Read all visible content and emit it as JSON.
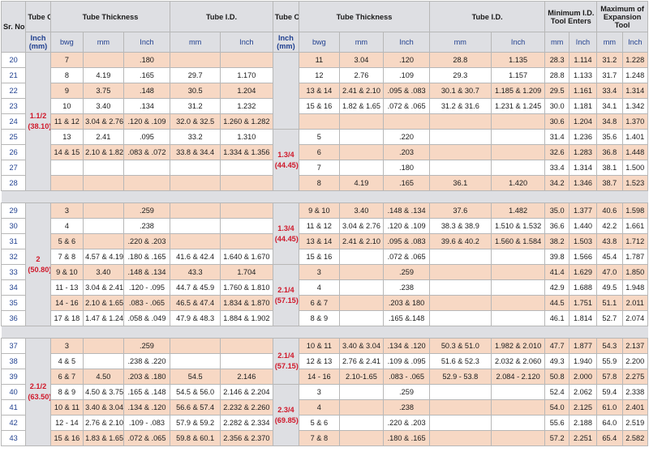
{
  "headers": {
    "sr_no": "Sr. No.",
    "tube_od": "Tube O.D.",
    "tube_thickness": "Tube Thickness",
    "tube_id": "Tube I.D.",
    "min_id_tool_enters": "Minimum I.D. Tool Enters",
    "max_expansion_tool": "Maximum of Expansion Tool",
    "inch_mm": "Inch (mm)",
    "bwg": "bwg",
    "mm": "mm",
    "inch": "Inch"
  },
  "sections": [
    {
      "left_od": "1.1/2\n(38.10)",
      "rows": [
        {
          "sr": "20",
          "lb": "7",
          "lm": "",
          "li": ".180",
          "im": "",
          "ii": "",
          "rod": "",
          "rb": "11",
          "rm": "3.04",
          "ri": ".120",
          "rim": "28.8",
          "rii": "1.135",
          "mm": "28.3",
          "mi": "1.114",
          "xm": "31.2",
          "xi": "1.228"
        },
        {
          "sr": "21",
          "lb": "8",
          "lm": "4.19",
          "li": ".165",
          "im": "29.7",
          "ii": "1.170",
          "rod": "1.3/8\n(34.92)",
          "rb": "12",
          "rm": "2.76",
          "ri": ".109",
          "rim": "29.3",
          "rii": "1.157",
          "mm": "28.8",
          "mi": "1.133",
          "xm": "31.7",
          "xi": "1.248"
        },
        {
          "sr": "22",
          "lb": "9",
          "lm": "3.75",
          "li": ".148",
          "im": "30.5",
          "ii": "1.204",
          "rod": "",
          "rb": "13 & 14",
          "rm": "2.41 & 2.10",
          "ri": ".095 & .083",
          "rim": "30.1 & 30.7",
          "rii": "1.185 & 1.209",
          "mm": "29.5",
          "mi": "1.161",
          "xm": "33.4",
          "xi": "1.314"
        },
        {
          "sr": "23",
          "lb": "10",
          "lm": "3.40",
          "li": ".134",
          "im": "31.2",
          "ii": "1.232",
          "rod": "",
          "rb": "15 & 16",
          "rm": "1.82 & 1.65",
          "ri": ".072 & .065",
          "rim": "31.2 & 31.6",
          "rii": "1.231 & 1.245",
          "mm": "30.0",
          "mi": "1.181",
          "xm": "34.1",
          "xi": "1.342"
        },
        {
          "sr": "24",
          "lb": "11 & 12",
          "lm": "3.04 & 2.76",
          "li": ".120 & .109",
          "im": "32.0 & 32.5",
          "ii": "1.260 & 1.282",
          "rod": "",
          "rb": "",
          "rm": "",
          "ri": "",
          "rim": "",
          "rii": "",
          "mm": "30.6",
          "mi": "1.204",
          "xm": "34.8",
          "xi": "1.370"
        },
        {
          "sr": "25",
          "lb": "13",
          "lm": "2.41",
          "li": ".095",
          "im": "33.2",
          "ii": "1.310",
          "rod": "1.3/4\n(44.45)",
          "rb": "5",
          "rm": "",
          "ri": ".220",
          "rim": "",
          "rii": "",
          "mm": "31.4",
          "mi": "1.236",
          "xm": "35.6",
          "xi": "1.401"
        },
        {
          "sr": "26",
          "lb": "14 & 15",
          "lm": "2.10 & 1.82",
          "li": ".083 & .072",
          "im": "33.8 & 34.4",
          "ii": "1.334 & 1.356",
          "rod": "",
          "rb": "6",
          "rm": "",
          "ri": ".203",
          "rim": "",
          "rii": "",
          "mm": "32.6",
          "mi": "1.283",
          "xm": "36.8",
          "xi": "1.448"
        },
        {
          "sr": "27",
          "lb": "",
          "lm": "",
          "li": "",
          "im": "",
          "ii": "",
          "rod": "",
          "rb": "7",
          "rm": "",
          "ri": ".180",
          "rim": "",
          "rii": "",
          "mm": "33.4",
          "mi": "1.314",
          "xm": "38.1",
          "xi": "1.500"
        },
        {
          "sr": "28",
          "lb": "",
          "lm": "",
          "li": "",
          "im": "",
          "ii": "",
          "rod": "",
          "rb": "8",
          "rm": "4.19",
          "ri": ".165",
          "rim": "36.1",
          "rii": "1.420",
          "mm": "34.2",
          "mi": "1.346",
          "xm": "38.7",
          "xi": "1.523"
        }
      ]
    },
    {
      "left_od": "2\n(50.80)",
      "rows": [
        {
          "sr": "29",
          "lb": "3",
          "lm": "",
          "li": ".259",
          "im": "",
          "ii": "",
          "rod": "1.3/4\n(44.45)",
          "rb": "9 & 10",
          "rm": "3.40",
          "ri": ".148 & .134",
          "rim": "37.6",
          "rii": "1.482",
          "mm": "35.0",
          "mi": "1.377",
          "xm": "40.6",
          "xi": "1.598"
        },
        {
          "sr": "30",
          "lb": "4",
          "lm": "",
          "li": ".238",
          "im": "",
          "ii": "",
          "rod": "",
          "rb": "11 & 12",
          "rm": "3.04 & 2.76",
          "ri": ".120 & .109",
          "rim": "38.3 & 38.9",
          "rii": "1.510 & 1.532",
          "mm": "36.6",
          "mi": "1.440",
          "xm": "42.2",
          "xi": "1.661"
        },
        {
          "sr": "31",
          "lb": "5 & 6",
          "lm": "",
          "li": ".220 & .203",
          "im": "",
          "ii": "",
          "rod": "",
          "rb": "13 & 14",
          "rm": "2.41 & 2.10",
          "ri": ".095 & .083",
          "rim": "39.6 & 40.2",
          "rii": "1.560 & 1.584",
          "mm": "38.2",
          "mi": "1.503",
          "xm": "43.8",
          "xi": "1.712"
        },
        {
          "sr": "32",
          "lb": "7 & 8",
          "lm": "4.57 & 4.19",
          "li": ".180 & .165",
          "im": "41.6 & 42.4",
          "ii": "1.640 & 1.670",
          "rod": "",
          "rb": "15 & 16",
          "rm": "",
          "ri": ".072 & .065",
          "rim": "",
          "rii": "",
          "mm": "39.8",
          "mi": "1.566",
          "xm": "45.4",
          "xi": "1.787"
        },
        {
          "sr": "33",
          "lb": "9 & 10",
          "lm": "3.40",
          "li": ".148 & .134",
          "im": "43.3",
          "ii": "1.704",
          "rod": "2.1/4\n(57.15)",
          "rb": "3",
          "rm": "",
          "ri": ".259",
          "rim": "",
          "rii": "",
          "mm": "41.4",
          "mi": "1.629",
          "xm": "47.0",
          "xi": "1.850"
        },
        {
          "sr": "34",
          "lb": "11 - 13",
          "lm": "3.04 & 2.41",
          "li": ".120 - .095",
          "im": "44.7 & 45.9",
          "ii": "1.760 & 1.810",
          "rod": "",
          "rb": "4",
          "rm": "",
          "ri": ".238",
          "rim": "",
          "rii": "",
          "mm": "42.9",
          "mi": "1.688",
          "xm": "49.5",
          "xi": "1.948"
        },
        {
          "sr": "35",
          "lb": "14 - 16",
          "lm": "2.10 & 1.65",
          "li": ".083 - .065",
          "im": "46.5 & 47.4",
          "ii": "1.834 & 1.870",
          "rod": "",
          "rb": "6 & 7",
          "rm": "",
          "ri": ".203 & 180",
          "rim": "",
          "rii": "",
          "mm": "44.5",
          "mi": "1.751",
          "xm": "51.1",
          "xi": "2.011"
        },
        {
          "sr": "36",
          "lb": "17 & 18",
          "lm": "1.47 & 1.24",
          "li": ".058 & .049",
          "im": "47.9 & 48.3",
          "ii": "1.884 & 1.902",
          "rod": "",
          "rb": "8 & 9",
          "rm": "",
          "ri": ".165 &.148",
          "rim": "",
          "rii": "",
          "mm": "46.1",
          "mi": "1.814",
          "xm": "52.7",
          "xi": "2.074"
        }
      ]
    },
    {
      "left_od": "2.1/2\n(63.50)",
      "rows": [
        {
          "sr": "37",
          "lb": "3",
          "lm": "",
          "li": ".259",
          "im": "",
          "ii": "",
          "rod": "2.1/4\n(57.15)",
          "rb": "10 & 11",
          "rm": "3.40 & 3.04",
          "ri": ".134 & .120",
          "rim": "50.3 & 51.0",
          "rii": "1.982 & 2.010",
          "mm": "47.7",
          "mi": "1.877",
          "xm": "54.3",
          "xi": "2.137"
        },
        {
          "sr": "38",
          "lb": "4 & 5",
          "lm": "",
          "li": ".238 & .220",
          "im": "",
          "ii": "",
          "rod": "",
          "rb": "12 & 13",
          "rm": "2.76 & 2.41",
          "ri": ".109 & .095",
          "rim": "51.6 & 52.3",
          "rii": "2.032 & 2.060",
          "mm": "49.3",
          "mi": "1.940",
          "xm": "55.9",
          "xi": "2.200"
        },
        {
          "sr": "39",
          "lb": "6 & 7",
          "lm": "4.50",
          "li": ".203 & .180",
          "im": "54.5",
          "ii": "2.146",
          "rod": "",
          "rb": "14 - 16",
          "rm": "2.10-1.65",
          "ri": ".083 - .065",
          "rim": "52.9 - 53.8",
          "rii": "2.084 - 2.120",
          "mm": "50.8",
          "mi": "2.000",
          "xm": "57.8",
          "xi": "2.275"
        },
        {
          "sr": "40",
          "lb": "8 & 9",
          "lm": "4.50 & 3.75",
          "li": ".165 & .148",
          "im": "54.5 & 56.0",
          "ii": "2.146 & 2.204",
          "rod": "2.3/4\n(69.85)",
          "rb": "3",
          "rm": "",
          "ri": ".259",
          "rim": "",
          "rii": "",
          "mm": "52.4",
          "mi": "2.062",
          "xm": "59.4",
          "xi": "2.338"
        },
        {
          "sr": "41",
          "lb": "10 & 11",
          "lm": "3.40 & 3.04",
          "li": ".134 & .120",
          "im": "56.6 & 57.4",
          "ii": "2.232 & 2.260",
          "rod": "",
          "rb": "4",
          "rm": "",
          "ri": ".238",
          "rim": "",
          "rii": "",
          "mm": "54.0",
          "mi": "2.125",
          "xm": "61.0",
          "xi": "2.401"
        },
        {
          "sr": "42",
          "lb": "12 - 14",
          "lm": "2.76 & 2.10",
          "li": ".109 - .083",
          "im": "57.9 & 59.2",
          "ii": "2.282 & 2.334",
          "rod": "",
          "rb": "5 & 6",
          "rm": "",
          "ri": ".220 & .203",
          "rim": "",
          "rii": "",
          "mm": "55.6",
          "mi": "2.188",
          "xm": "64.0",
          "xi": "2.519"
        },
        {
          "sr": "43",
          "lb": "15 & 16",
          "lm": "1.83 & 1.65",
          "li": ".072 & .065",
          "im": "59.8 & 60.1",
          "ii": "2.356 & 2.370",
          "rod": "",
          "rb": "7 & 8",
          "rm": "",
          "ri": ".180 & .165",
          "rim": "",
          "rii": "",
          "mm": "57.2",
          "mi": "2.251",
          "xm": "65.4",
          "xi": "2.582"
        }
      ]
    }
  ],
  "right_od_spans": [
    [
      {
        "row": 0,
        "span": 5
      },
      {
        "row": 5,
        "span": 4
      }
    ],
    [
      {
        "row": 0,
        "span": 4
      },
      {
        "row": 4,
        "span": 4
      }
    ],
    [
      {
        "row": 0,
        "span": 3
      },
      {
        "row": 3,
        "span": 4
      }
    ]
  ],
  "colors": {
    "header_bg": "#dedfe3",
    "band": "#f7d8c4",
    "od_text": "#d0182a",
    "sr_text": "#1f3f8f"
  }
}
